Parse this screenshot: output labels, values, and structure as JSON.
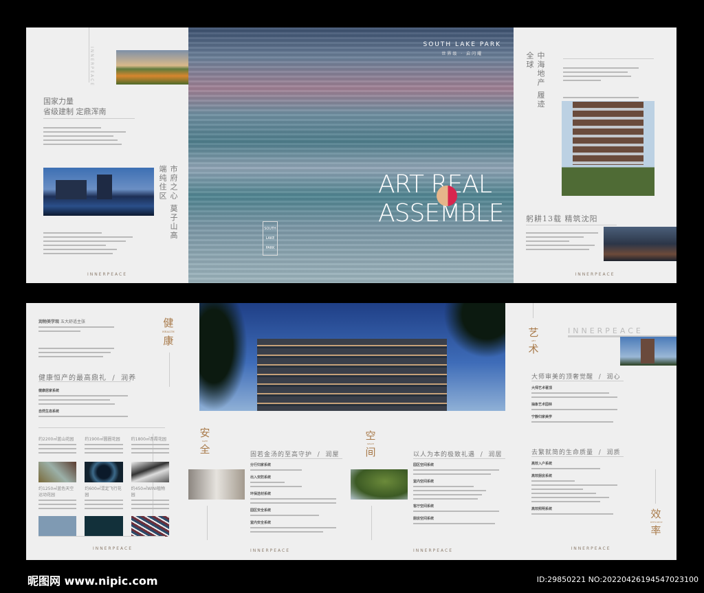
{
  "top_left": {
    "title_line1": "国家力量",
    "title_line2": "省级建制 定鼎浑南",
    "vertical_title": "市府之心 莫子山高端纯住区",
    "side_brand": "INNERPEACE",
    "logo": "INNERPEACE"
  },
  "cover": {
    "brand": "SOUTH LAKE PARK",
    "tagline": "世界级 · 启闪耀",
    "headline1": "ART REAL",
    "headline2": "ASSEMBLE",
    "badge_lines": [
      "SOUTH",
      "LAKE",
      "PARK"
    ]
  },
  "top_right": {
    "vertical_title": "中海地产 履迹全球",
    "subtitle": "躬耕13载 精筑沈阳",
    "logo": "INNERPEACE"
  },
  "bottom_left": {
    "intro_title": "润物美学观",
    "intro_suffix": "五大舒适主张",
    "char1": "健",
    "char2": "康",
    "en": "HEALTH",
    "heading": "健康恒产的最高鼎礼",
    "heading_tag": "润养",
    "systems": [
      "健康居家系统",
      "自然生态系统"
    ],
    "gardens": [
      "约2200㎡蓝山花园",
      "约1900㎡圆圈花园",
      "约1800㎡赤霞花园",
      "约1250㎡蓝色天空运动花园",
      "约600㎡混定飞行花园",
      "约450㎡WINI植物园"
    ],
    "logo": "INNERPEACE"
  },
  "bottom_mid": {
    "safe_char1": "安",
    "safe_char2": "全",
    "safe_en": "SAFE",
    "safe_heading": "固若金汤的至高守护",
    "safe_tag": "润屋",
    "safe_systems": [
      "分行归家系统",
      "出入安防系统",
      "环保选材系统",
      "园区安全系统",
      "室内安全系统"
    ],
    "space_char1": "空",
    "space_char2": "间",
    "space_en": "SPACE",
    "space_heading": "以人为本的极致礼遇",
    "space_tag": "润居",
    "space_systems": [
      "园区空间系统",
      "室内空间系统",
      "客厅空间系统",
      "厨房空间系统"
    ],
    "logo": "INNERPEACE"
  },
  "bottom_right": {
    "char1": "艺",
    "char2": "术",
    "en": "ART",
    "banner": "INNERPEACE",
    "heading1": "大师审美的顶奢觉醒",
    "tag1": "润心",
    "art_systems": [
      "大师艺术著顶",
      "抽象艺术园林",
      "宁静归家美学"
    ],
    "heading2": "去繁就简的生命质量",
    "tag2": "润质",
    "eff_systems": [
      "高效入户系统",
      "高效厨房系统",
      "高效照明系统"
    ],
    "eff_char1": "效",
    "eff_char2": "率",
    "eff_en": "EFFICIENT",
    "logo": "INNERPEACE"
  },
  "watermark": {
    "site": "昵图网 www.nipic.com",
    "id": "ID:29850221 NO:20220426194547023100"
  }
}
